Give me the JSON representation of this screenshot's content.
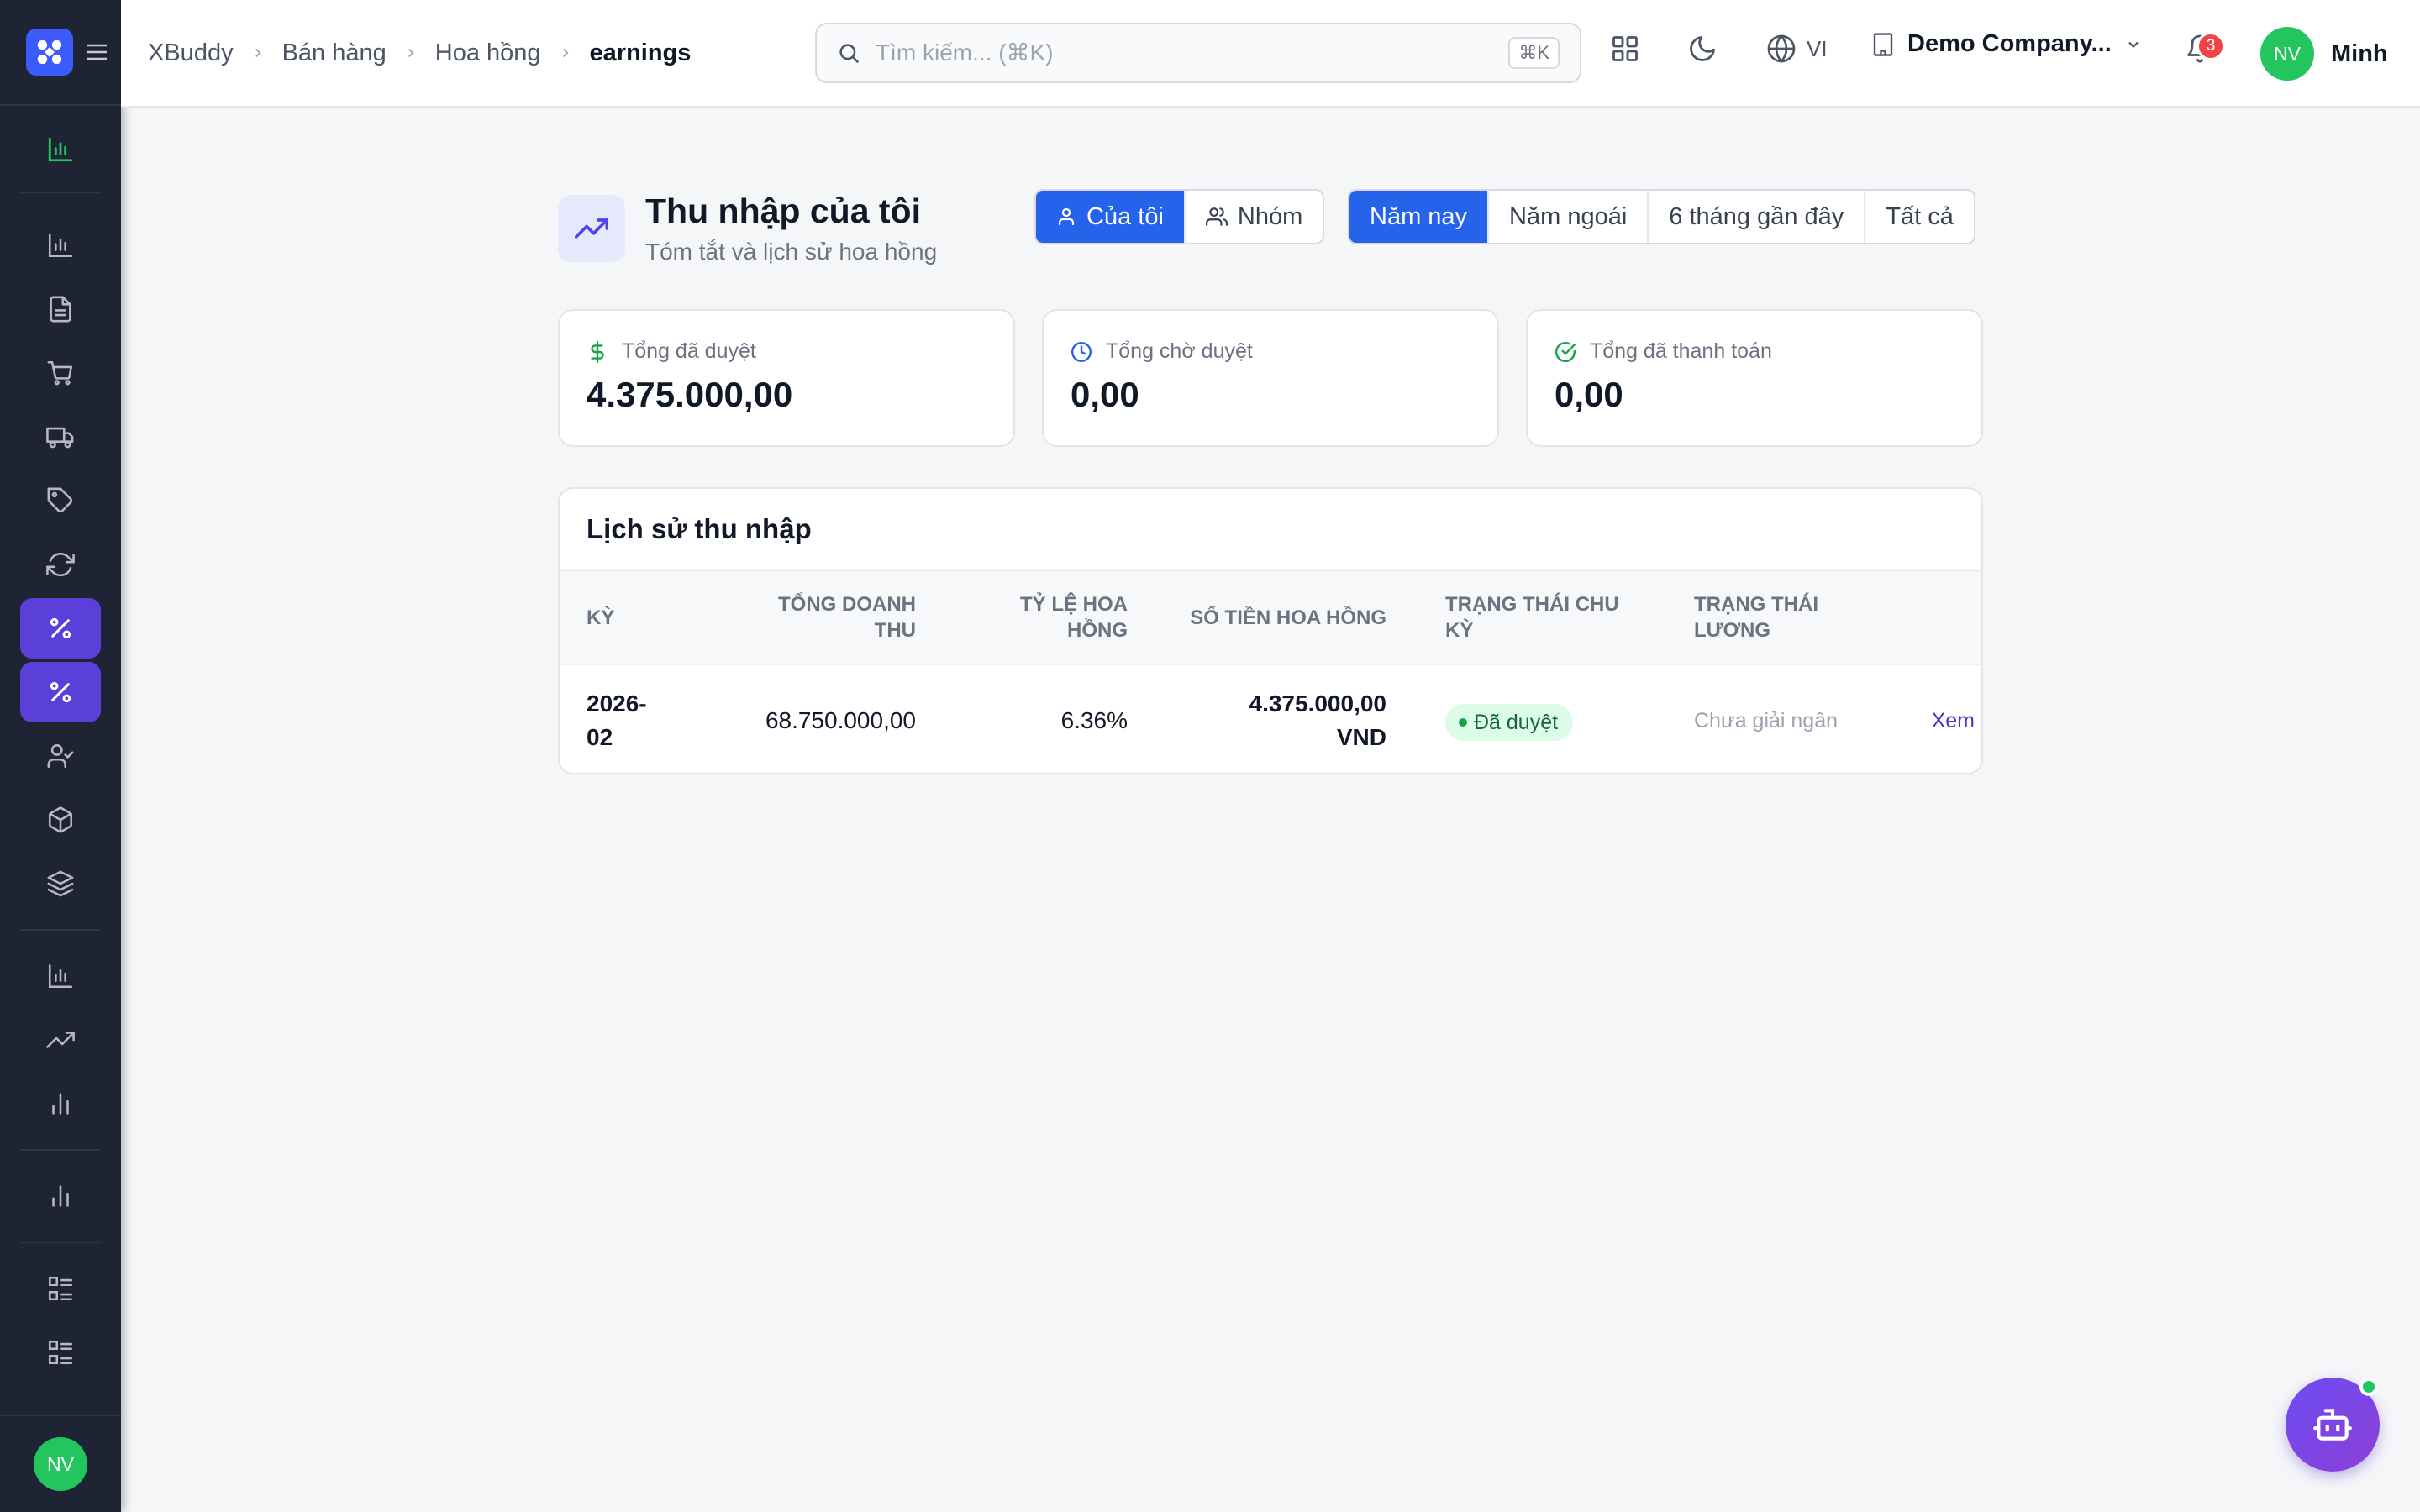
{
  "colors": {
    "accent": "#2563eb",
    "sidebar_bg": "#1e2433",
    "active_nav": "#5b3fd9",
    "success": "#22c55e",
    "danger": "#ef4444"
  },
  "sidebar": {
    "logo_icon": "x-logo-icon",
    "items": [
      {
        "icon": "bar-chart-icon",
        "active": false
      },
      {
        "icon": "bar-chart-icon",
        "active": false
      },
      {
        "icon": "document-icon",
        "active": false
      },
      {
        "icon": "cart-icon",
        "active": false
      },
      {
        "icon": "truck-icon",
        "active": false
      },
      {
        "icon": "tag-icon",
        "active": false
      },
      {
        "icon": "refresh-icon",
        "active": false
      },
      {
        "icon": "percent-icon",
        "active": true
      },
      {
        "icon": "percent-icon",
        "active": true
      },
      {
        "icon": "user-check-icon",
        "active": false
      },
      {
        "icon": "box-icon",
        "active": false
      },
      {
        "icon": "layers-icon",
        "active": false
      },
      {
        "icon": "bar-chart-icon",
        "active": false
      },
      {
        "icon": "trending-up-icon",
        "active": false
      },
      {
        "icon": "bar-chart-icon",
        "active": false
      },
      {
        "icon": "bar-chart-icon",
        "active": false
      },
      {
        "icon": "list-icon",
        "active": false
      },
      {
        "icon": "list-icon",
        "active": false
      }
    ],
    "footer_avatar": "NV"
  },
  "header": {
    "breadcrumbs": [
      "XBuddy",
      "Bán hàng",
      "Hoa hồng",
      "earnings"
    ],
    "search": {
      "placeholder": "Tìm kiếm... (⌘K)",
      "shortcut": "⌘K"
    },
    "language": "VI",
    "company": "Demo Company...",
    "notifications_count": "3",
    "user": {
      "initials": "NV",
      "name": "Minh"
    }
  },
  "page": {
    "title": "Thu nhập của tôi",
    "subtitle": "Tóm tắt và lịch sử hoa hồng",
    "scope_tabs": [
      {
        "label": "Của tôi",
        "active": true
      },
      {
        "label": "Nhóm",
        "active": false
      }
    ],
    "period_tabs": [
      {
        "label": "Năm nay",
        "active": true
      },
      {
        "label": "Năm ngoái",
        "active": false
      },
      {
        "label": "6 tháng gần đây",
        "active": false
      },
      {
        "label": "Tất cả",
        "active": false
      }
    ]
  },
  "summary": [
    {
      "label": "Tổng đã duyệt",
      "value": "4.375.000,00",
      "icon": "dollar-icon",
      "color": "#16a34a"
    },
    {
      "label": "Tổng chờ duyệt",
      "value": "0,00",
      "icon": "clock-icon",
      "color": "#2563eb"
    },
    {
      "label": "Tổng đã thanh toán",
      "value": "0,00",
      "icon": "check-circle-icon",
      "color": "#16a34a"
    }
  ],
  "history": {
    "title": "Lịch sử thu nhập",
    "columns": {
      "period": "Kỳ",
      "revenue_line1": "Tổng doanh",
      "revenue_line2": "thu",
      "rate_line1": "Tỷ lệ hoa",
      "rate_line2": "hồng",
      "amount": "Số tiền hoa hồng",
      "cycle_status_line1": "Trạng thái chu",
      "cycle_status_line2": "kỳ",
      "payroll_status_line1": "Trạng thái",
      "payroll_status_line2": "lương"
    },
    "rows": [
      {
        "period_line1": "2026-",
        "period_line2": "02",
        "revenue": "68.750.000,00",
        "rate": "6.36%",
        "amount_line1": "4.375.000,00",
        "amount_line2": "VND",
        "cycle_status": "Đã duyệt",
        "payroll_status": "Chưa giải ngân",
        "action": "Xem"
      }
    ]
  }
}
